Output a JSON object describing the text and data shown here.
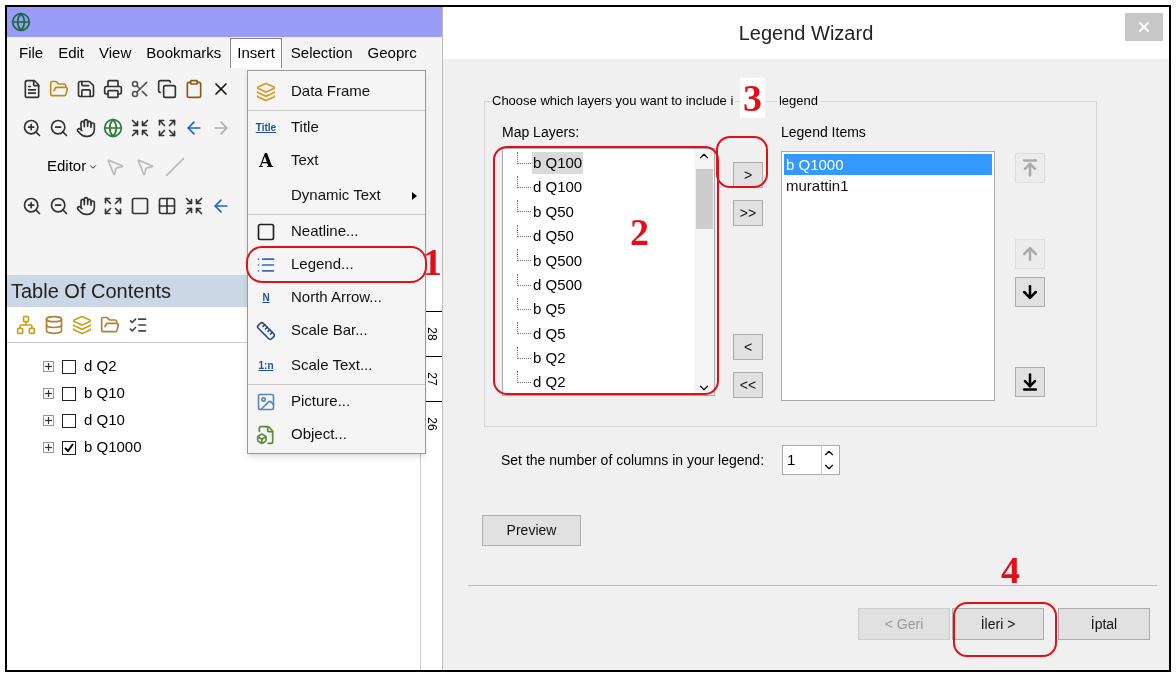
{
  "arcmap": {
    "menu_bar": [
      {
        "label": "File",
        "selected": false
      },
      {
        "label": "Edit",
        "selected": false
      },
      {
        "label": "View",
        "selected": false
      },
      {
        "label": "Bookmarks",
        "selected": false
      },
      {
        "label": "Insert",
        "selected": true
      },
      {
        "label": "Selection",
        "selected": false
      },
      {
        "label": "Geoprc",
        "selected": false
      }
    ],
    "editor_toolbar": {
      "label": "Editor"
    },
    "insert_menu": [
      {
        "label": "Data Frame",
        "separator_after": true,
        "submenu": false
      },
      {
        "label": "Title",
        "icon_text": "Title",
        "separator_after": false,
        "submenu": false
      },
      {
        "label": "Text",
        "icon_text": "A",
        "separator_after": false,
        "submenu": false
      },
      {
        "label": "Dynamic Text",
        "separator_after": true,
        "submenu": true
      },
      {
        "label": "Neatline...",
        "separator_after": false,
        "submenu": false
      },
      {
        "label": "Legend...",
        "separator_after": false,
        "submenu": false
      },
      {
        "label": "North Arrow...",
        "icon_text": "N",
        "separator_after": false,
        "submenu": false
      },
      {
        "label": "Scale Bar...",
        "separator_after": false,
        "submenu": false
      },
      {
        "label": "Scale Text...",
        "icon_text": "1:n",
        "separator_after": true,
        "submenu": false
      },
      {
        "label": "Picture...",
        "separator_after": false,
        "submenu": false
      },
      {
        "label": "Object...",
        "separator_after": false,
        "submenu": false
      }
    ],
    "table_of_contents": {
      "title": "Table Of Contents",
      "layers": [
        {
          "name": "d Q2",
          "checked": false,
          "expanded": false
        },
        {
          "name": "b Q10",
          "checked": false,
          "expanded": false
        },
        {
          "name": "d Q10",
          "checked": false,
          "expanded": false
        },
        {
          "name": "b Q1000",
          "checked": true,
          "expanded": false
        }
      ]
    },
    "ruler_labels": [
      "28",
      "27",
      "26"
    ]
  },
  "legend_wizard": {
    "title": "Legend Wizard",
    "group_title_before": "Choose which layers you want to include i",
    "group_title_after": "legend",
    "map_layers": {
      "label": "Map Layers:",
      "items": [
        {
          "name": "b Q100",
          "selected": true
        },
        {
          "name": "d Q100",
          "selected": false
        },
        {
          "name": "b Q50",
          "selected": false
        },
        {
          "name": "d Q50",
          "selected": false
        },
        {
          "name": "b Q500",
          "selected": false
        },
        {
          "name": "d Q500",
          "selected": false
        },
        {
          "name": "b Q5",
          "selected": false
        },
        {
          "name": "d Q5",
          "selected": false
        },
        {
          "name": "b Q2",
          "selected": false
        },
        {
          "name": "d Q2",
          "selected": false
        }
      ]
    },
    "move_buttons": {
      "add": ">",
      "add_all": ">>",
      "remove": "<",
      "remove_all": "<<"
    },
    "legend_items": {
      "label": "Legend Items",
      "items": [
        {
          "name": "b Q1000",
          "selected": true
        },
        {
          "name": "murattin1",
          "selected": false
        }
      ]
    },
    "order_buttons": [
      {
        "disabled": true
      },
      {
        "disabled": true
      },
      {
        "disabled": false
      },
      {
        "disabled": false
      }
    ],
    "columns": {
      "label": "Set the number of columns in your legend:",
      "value": "1"
    },
    "preview_button": "Preview",
    "buttons": [
      {
        "label": "< Geri",
        "disabled": true
      },
      {
        "label": "İleri >",
        "disabled": false
      },
      {
        "label": "İptal",
        "disabled": false
      }
    ]
  },
  "annotations": [
    {
      "label": "1"
    },
    {
      "label": "2"
    },
    {
      "label": "3"
    },
    {
      "label": "4"
    }
  ]
}
